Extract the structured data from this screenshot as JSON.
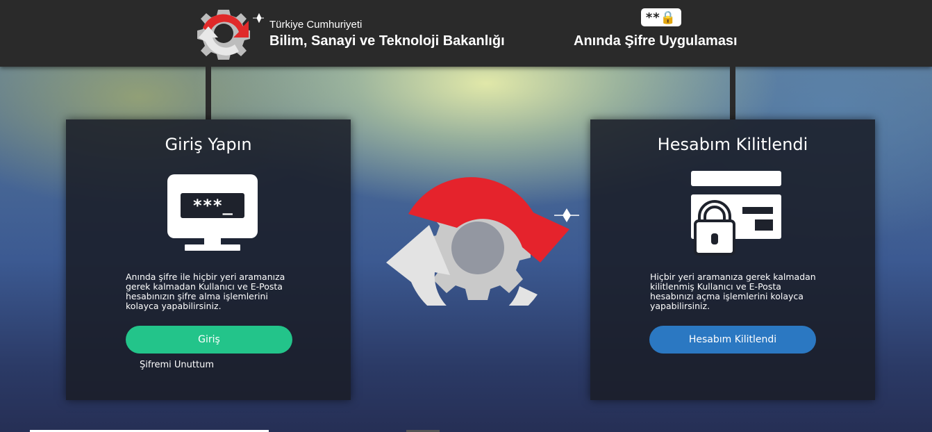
{
  "header": {
    "ministry_top": "Türkiye Cumhuriyeti",
    "ministry_main": "Bilim, Sanayi ve Teknoloji Bakanlığı",
    "badge_text": "**🔒",
    "app_title": "Anında Şifre Uygulaması"
  },
  "login_card": {
    "title": "Giriş Yapın",
    "screen_text": "***_",
    "description": "Anında şifre ile hiçbir yeri aramanıza gerek kalmadan Kullanıcı ve E-Posta hesabınızın şifre alma işlemlerini kolayca yapabilirsiniz.",
    "button_label": "Giriş",
    "forgot_link": "Şifremi Unuttum"
  },
  "locked_card": {
    "title": "Hesabım Kilitlendi",
    "description": "Hiçbir yeri aramanıza gerek kalmadan kilitlenmiş Kullanıcı ve E-Posta hesabınızı açma işlemlerini kolayca yapabilirsiniz.",
    "button_label": "Hesabım Kilitlendi"
  },
  "colors": {
    "header_bg": "#2a2a2a",
    "login_button": "#23c48a",
    "locked_button": "#2b78c2",
    "logo_red": "#e02a2a",
    "logo_gray": "#c8c8c8"
  },
  "icons": [
    "gear-logo-icon",
    "password-badge-icon",
    "monitor-password-icon",
    "id-card-lock-icon",
    "gear-refresh-icon"
  ]
}
